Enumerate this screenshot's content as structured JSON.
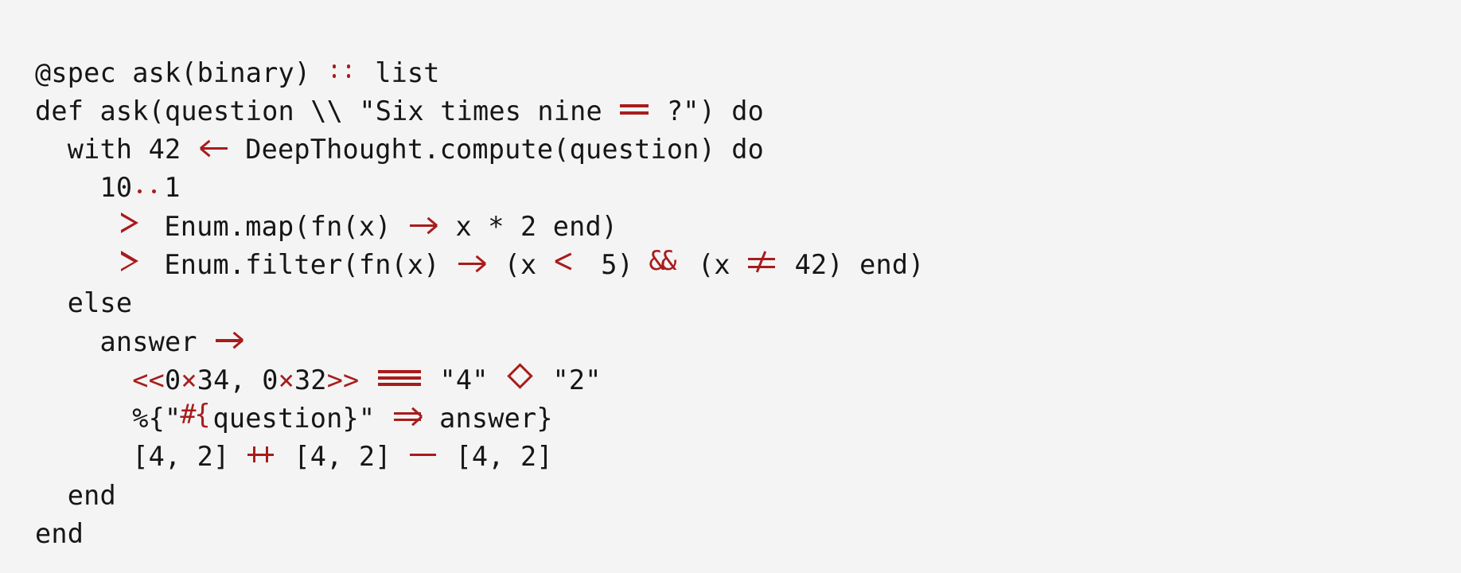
{
  "document": {
    "kind": "code-snippet",
    "language": "Elixir",
    "background_color": "#f4f4f4",
    "text_color": "#161616",
    "operator_color": "#a81c1c",
    "font_style": "monospace-with-programming-ligatures"
  },
  "code": {
    "lines": [
      {
        "id": "line-1",
        "indent": 0,
        "plain": "@spec ask(binary) :: list",
        "tokens": [
          {
            "type": "text",
            "text": "@spec ask(binary) "
          },
          {
            "type": "lig",
            "lig": "coloncolon",
            "text": "::"
          },
          {
            "type": "text",
            "text": " list"
          }
        ]
      },
      {
        "id": "line-2",
        "indent": 0,
        "plain": "def ask(question \\\\ \"Six times nine == ?\") do",
        "tokens": [
          {
            "type": "text",
            "text": "def ask(question \\\\ \"Six times nine "
          },
          {
            "type": "lig",
            "lig": "eqeq",
            "text": "=="
          },
          {
            "type": "text",
            "text": " ?\") do"
          }
        ]
      },
      {
        "id": "line-3",
        "indent": 2,
        "plain": "  with 42 <- DeepThought.compute(question) do",
        "tokens": [
          {
            "type": "text",
            "text": "  with 42 "
          },
          {
            "type": "lig",
            "lig": "larrow",
            "text": "<-"
          },
          {
            "type": "text",
            "text": " DeepThought.compute(question) do"
          }
        ]
      },
      {
        "id": "line-4",
        "indent": 4,
        "plain": "    10..1",
        "tokens": [
          {
            "type": "text",
            "text": "    10"
          },
          {
            "type": "lig",
            "lig": "dotdot",
            "text": ".."
          },
          {
            "type": "text",
            "text": "1"
          }
        ]
      },
      {
        "id": "line-5",
        "indent": 5,
        "plain": "     |> Enum.map(fn(x) -> x * 2 end)",
        "tokens": [
          {
            "type": "text",
            "text": "     "
          },
          {
            "type": "lig",
            "lig": "pipe",
            "text": "|>"
          },
          {
            "type": "text",
            "text": " Enum.map(fn(x) "
          },
          {
            "type": "lig",
            "lig": "rarrow",
            "text": "->"
          },
          {
            "type": "text",
            "text": " x * 2 end)"
          }
        ]
      },
      {
        "id": "line-6",
        "indent": 5,
        "plain": "     |> Enum.filter(fn(x) -> (x <= 5) && (x != 42) end)",
        "tokens": [
          {
            "type": "text",
            "text": "     "
          },
          {
            "type": "lig",
            "lig": "pipe",
            "text": "|>"
          },
          {
            "type": "text",
            "text": " Enum.filter(fn(x) "
          },
          {
            "type": "lig",
            "lig": "rarrow",
            "text": "->"
          },
          {
            "type": "text",
            "text": " (x "
          },
          {
            "type": "lig",
            "lig": "le",
            "text": "<="
          },
          {
            "type": "text",
            "text": " 5) "
          },
          {
            "type": "lig",
            "lig": "ampamp",
            "text": "&&"
          },
          {
            "type": "text",
            "text": " (x "
          },
          {
            "type": "lig",
            "lig": "ne",
            "text": "!="
          },
          {
            "type": "text",
            "text": " 42) end)"
          }
        ]
      },
      {
        "id": "line-7",
        "indent": 2,
        "plain": "  else",
        "tokens": [
          {
            "type": "text",
            "text": "  else"
          }
        ]
      },
      {
        "id": "line-8",
        "indent": 4,
        "plain": "    answer ->",
        "tokens": [
          {
            "type": "text",
            "text": "    answer "
          },
          {
            "type": "lig",
            "lig": "rarrow",
            "text": "->"
          }
        ]
      },
      {
        "id": "line-9",
        "indent": 6,
        "plain": "      <<0x34, 0x32>> === \"4\" <> \"2\"",
        "tokens": [
          {
            "type": "text",
            "text": "      "
          },
          {
            "type": "op",
            "text": "<<"
          },
          {
            "type": "text",
            "text": "0"
          },
          {
            "type": "times",
            "text": "×"
          },
          {
            "type": "text",
            "text": "34, 0"
          },
          {
            "type": "times",
            "text": "×"
          },
          {
            "type": "text",
            "text": "32"
          },
          {
            "type": "op",
            "text": ">>"
          },
          {
            "type": "text",
            "text": " "
          },
          {
            "type": "lig",
            "lig": "eqeqeq",
            "text": "==="
          },
          {
            "type": "text",
            "text": " \"4\" "
          },
          {
            "type": "lig",
            "lig": "diamond",
            "text": "<>"
          },
          {
            "type": "text",
            "text": " \"2\""
          }
        ]
      },
      {
        "id": "line-10",
        "indent": 6,
        "plain": "      %{\"#{question}\" => answer}",
        "tokens": [
          {
            "type": "text",
            "text": "      %{\""
          },
          {
            "type": "lig",
            "lig": "interp",
            "text": "#{"
          },
          {
            "type": "text",
            "text": "question}\" "
          },
          {
            "type": "lig",
            "lig": "darrow",
            "text": "=>"
          },
          {
            "type": "text",
            "text": " answer}"
          }
        ]
      },
      {
        "id": "line-11",
        "indent": 6,
        "plain": "      [4, 2] ++ [4, 2] -- [4, 2]",
        "tokens": [
          {
            "type": "text",
            "text": "      [4, 2] "
          },
          {
            "type": "lig",
            "lig": "plusplus",
            "text": "++"
          },
          {
            "type": "text",
            "text": " [4, 2] "
          },
          {
            "type": "lig",
            "lig": "minusminus",
            "text": "--"
          },
          {
            "type": "text",
            "text": " [4, 2]"
          }
        ]
      },
      {
        "id": "line-12",
        "indent": 2,
        "plain": "  end",
        "tokens": [
          {
            "type": "text",
            "text": "  end"
          }
        ]
      },
      {
        "id": "line-13",
        "indent": 0,
        "plain": "end",
        "tokens": [
          {
            "type": "text",
            "text": "end"
          }
        ]
      }
    ]
  }
}
